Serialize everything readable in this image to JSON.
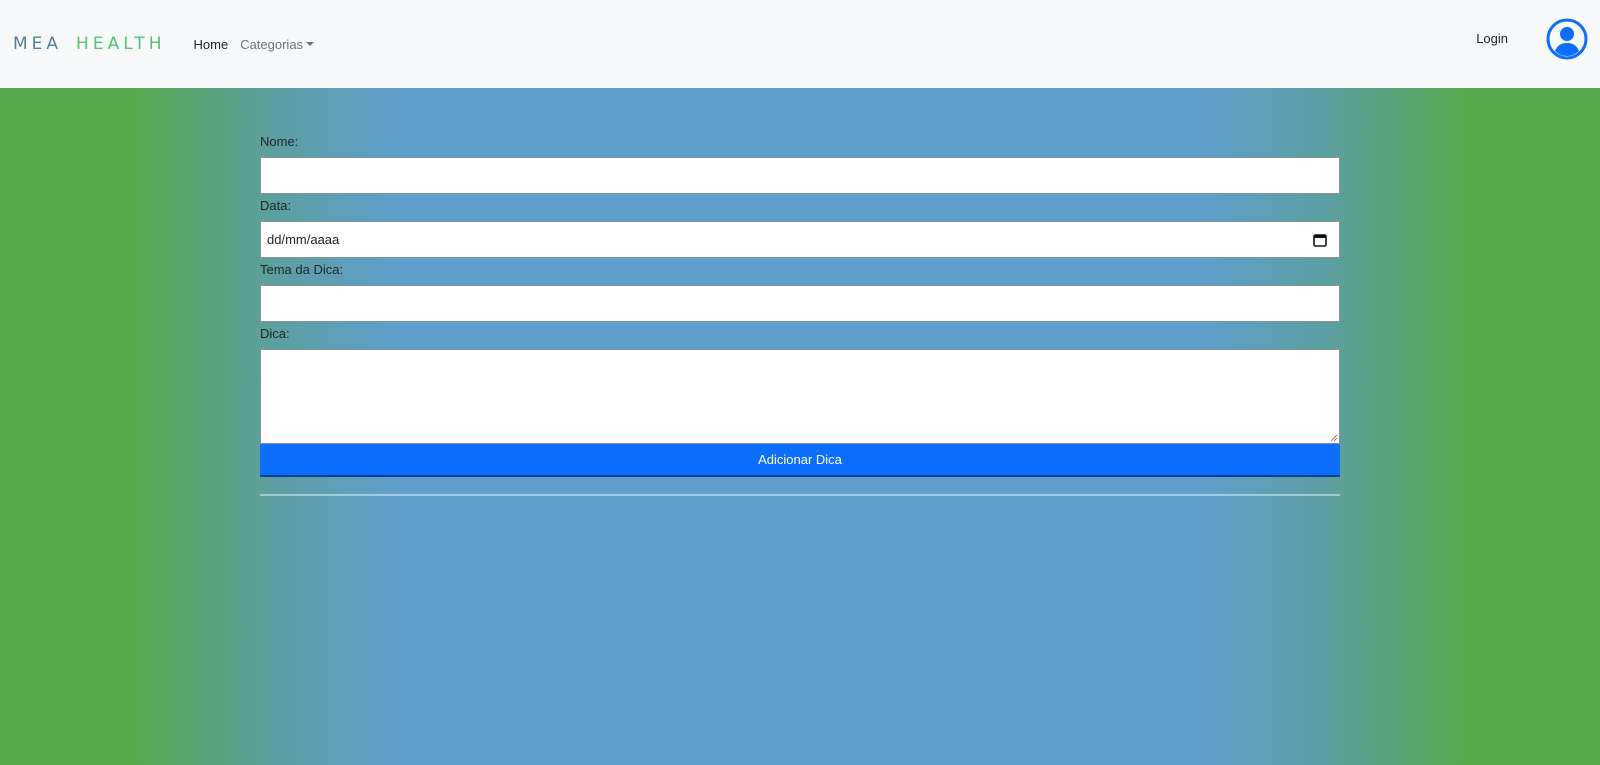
{
  "navbar": {
    "brand_part1": "MEA",
    "brand_part2": "HEALTH",
    "home_label": "Home",
    "categories_label": "Categorias",
    "login_label": "Login",
    "user_icon": "user-circle-icon"
  },
  "form": {
    "name_label": "Nome:",
    "name_value": "",
    "date_label": "Data:",
    "date_placeholder": "dd/mm/aaaa",
    "theme_label": "Tema da Dica:",
    "theme_value": "",
    "tip_label": "Dica:",
    "tip_value": "",
    "submit_label": "Adicionar Dica"
  },
  "colors": {
    "primary": "#0d6efd",
    "background_green": "#57a84a",
    "background_blue": "#5f9fcc",
    "brand_blue": "#4f7f9c",
    "brand_green": "#52c46a"
  }
}
